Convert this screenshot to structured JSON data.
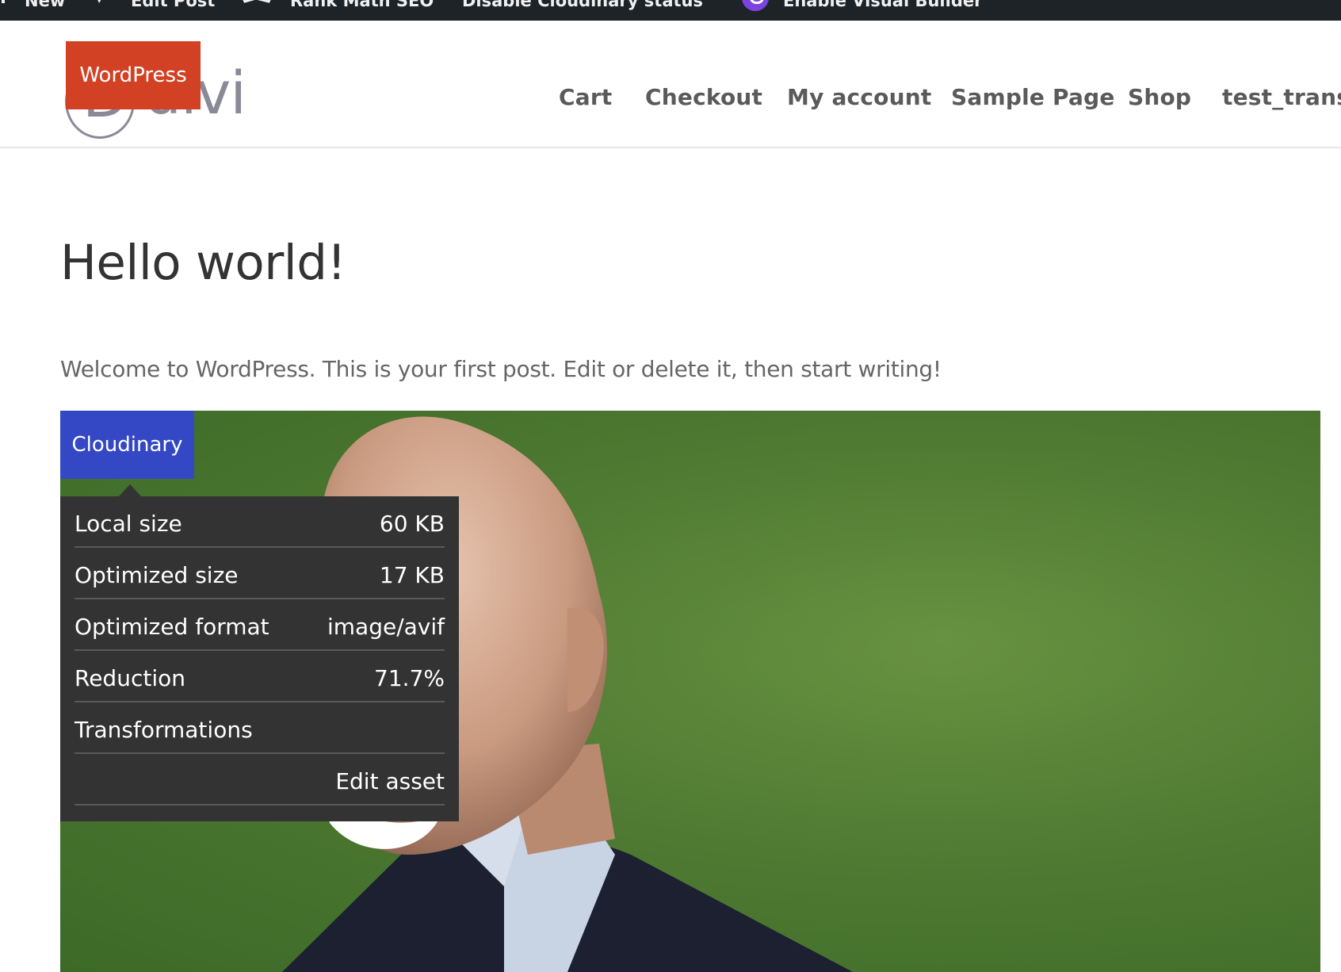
{
  "admin_bar": {
    "items": [
      "New",
      "Edit Post",
      "Rank Math SEO",
      "Disable Cloudinary status",
      "Enable Visual Builder"
    ]
  },
  "header": {
    "logo_text": "divi",
    "logo_letter": "D",
    "wp_badge": "WordPress",
    "nav": [
      "Cart",
      "Checkout",
      "My account",
      "Sample Page",
      "Shop",
      "test_transf"
    ]
  },
  "post": {
    "title": "Hello world!",
    "text": "Welcome to WordPress. This is your first post. Edit or delete it, then start writing!"
  },
  "cloudinary": {
    "tag": "Cloudinary",
    "rows": [
      {
        "label": "Local size",
        "value": "60 KB"
      },
      {
        "label": "Optimized size",
        "value": "17 KB"
      },
      {
        "label": "Optimized format",
        "value": "image/avif"
      },
      {
        "label": "Reduction",
        "value": "71.7%"
      },
      {
        "label": "Transformations",
        "value": ""
      }
    ],
    "edit_label": "Edit asset"
  },
  "colors": {
    "admin_bar": "#1d2327",
    "wp_badge": "#d24123",
    "cloudinary_tag": "#3448c5",
    "panel": "#333333",
    "grass": "#4f7b33"
  }
}
